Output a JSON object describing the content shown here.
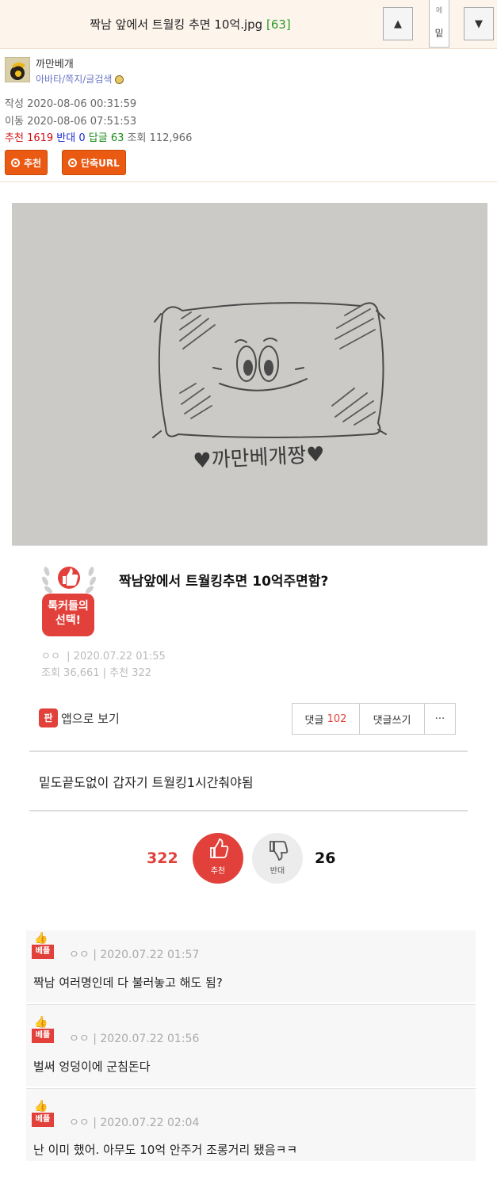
{
  "header": {
    "title": "짝남 앞에서 트월킹 추면 10억.jpg",
    "reply_count": "[63]",
    "up_icon": "▲",
    "down_icon": "▼",
    "side_tab_top": "메",
    "side_tab_bottom": "밑"
  },
  "author": {
    "nickname": "까만베개",
    "links": "아바타/쪽지/글검색"
  },
  "meta": {
    "written_label": "작성",
    "written_date": "2020-08-06 00:31:59",
    "moved_label": "이동",
    "moved_date": "2020-08-06 07:51:53",
    "recommend_label": "추천",
    "recommend_count": "1619",
    "oppose_label": "반대",
    "oppose_count": "0",
    "reply_label": "답글",
    "reply_count": "63",
    "views_label": "조회",
    "views_count": "112,966"
  },
  "buttons": {
    "recommend": "추천",
    "short_url": "단축URL"
  },
  "drawing": {
    "signature": "♥까만베개짱♥"
  },
  "screenshot": {
    "badge": "톡커들의 선택!",
    "title": "짝남앞에서 트월킹추면 10억주면함?",
    "author": "ㅇㅇ",
    "date": "2020.07.22 01:55",
    "stats": "조회 36,661 | 추천 322",
    "app_icon": "판",
    "app_view": "앱으로 보기",
    "comments_label": "댓글",
    "comments_count": "102",
    "write_comment": "댓글쓰기",
    "more": "···",
    "body": "밑도끝도없이 갑자기 트월킹1시간춰야됨",
    "up_count": "322",
    "up_label": "추천",
    "down_count": "26",
    "down_label": "반대",
    "comments": [
      {
        "badge": "베플",
        "author": "ㅇㅇ",
        "date": "2020.07.22 01:57",
        "text": "짝남 여러명인데 다 불러놓고 해도 됨?"
      },
      {
        "badge": "베플",
        "author": "ㅇㅇ",
        "date": "2020.07.22 01:56",
        "text": "벌써 엉덩이에 군침돈다"
      },
      {
        "badge": "베플",
        "author": "ㅇㅇ",
        "date": "2020.07.22 02:04",
        "text": "난 이미 했어. 아무도 10억 안주거 조롱거리 됐음ㅋㅋ"
      }
    ]
  },
  "colors": {
    "accent": "#ea5a12",
    "header_bg": "#fdf4ec",
    "pann_red": "#e1413a"
  }
}
